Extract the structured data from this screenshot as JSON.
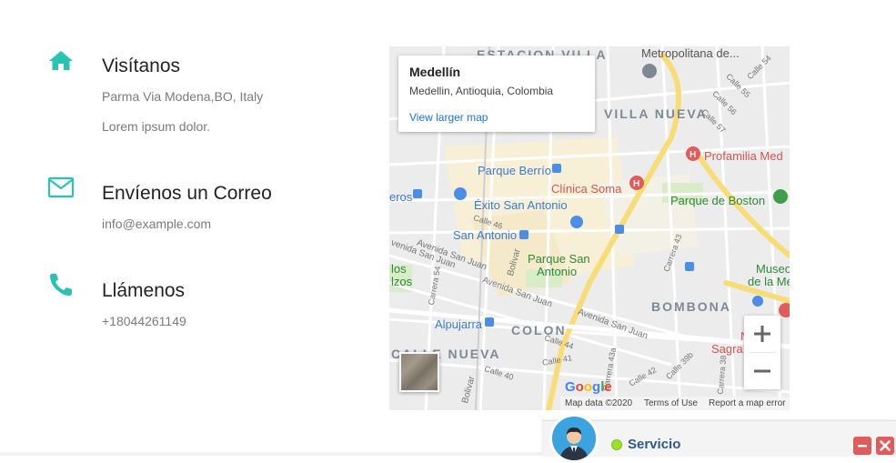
{
  "contact": {
    "visit": {
      "title": "Visítanos",
      "address": "Parma Via Modena,BO, Italy",
      "note": "Lorem ipsum dolor."
    },
    "email": {
      "title": "Envíenos un Correo",
      "value": "info@example.com"
    },
    "phone": {
      "title": "Llámenos",
      "value": "+18044261149"
    }
  },
  "map": {
    "place_title": "Medellín",
    "place_address": "Medellin, Antioquia, Colombia",
    "view_larger": "View larger map",
    "districts": {
      "estacion_villa": "ESTACION VILLA",
      "villa_nueva": "VILLA NUEVA",
      "bombona": "BOMBONA",
      "colon": "COLON",
      "calle_nueva": "CALLE NUEVA"
    },
    "pois": {
      "metropolitana": "Metropolitana de...",
      "parque_berrio": "Parque Berrío",
      "clinica_soma": "Clínica Soma",
      "profamilia": "Profamilia Med",
      "parque_boston": "Parque de Boston",
      "exito": "Éxito San Antonio",
      "san_antonio": "San Antonio",
      "parque_san_antonio_1": "Parque San",
      "parque_san_antonio_2": "Antonio",
      "museo_1": "Museo",
      "museo_2": "de la Me",
      "alpujarra": "Alpujarra",
      "nuevo_sagrado_1": "Nu",
      "nuevo_sagrado_2": "Sagra",
      "left_eros": "eros",
      "left_los": "los",
      "left_zos": "lzos"
    },
    "streets": {
      "av_san_juan_1": "Avenida San Juan",
      "av_san_juan_2": "Avenida San Juan",
      "av_san_juan_3": "Avenida San Juan",
      "av_san_juan_4": "venida San Juan",
      "calle_46": "Calle 46",
      "calle_44": "Calle 44",
      "calle_42": "Calle 42",
      "calle_40": "Calle 40",
      "calle_57": "Calle 57",
      "calle_56": "Calle 56",
      "calle_55": "Calle 55",
      "calle_54": "Calle 54",
      "carrera_43": "Carrera 43",
      "carrera_54": "Carrera 54",
      "carrera_38": "Carrera 38",
      "carrera_43a": "Carrera 43a",
      "carrera_39b": "Calle 39b",
      "calle_41": "Calle 41",
      "bolivar_1": "Bolivar",
      "bolivar_2": "Bolivar"
    },
    "zoom_in": "+",
    "zoom_out": "−",
    "logo": [
      "G",
      "o",
      "o",
      "g",
      "l",
      "e"
    ],
    "logo_colors": [
      "#4285F4",
      "#EA4335",
      "#FBBC05",
      "#4285F4",
      "#34A853",
      "#EA4335"
    ],
    "footer": {
      "data": "Map data ©2020",
      "terms": "Terms of Use",
      "report": "Report a map error"
    }
  },
  "chat": {
    "label": "Servicio",
    "status_color": "#9be22c",
    "minimize": "−",
    "close": "×"
  },
  "colors": {
    "accent": "#29c3b4",
    "link": "#1a73e8"
  }
}
